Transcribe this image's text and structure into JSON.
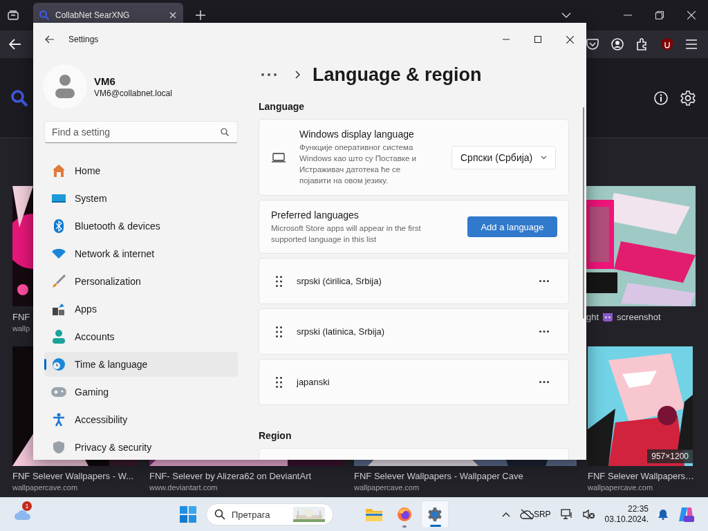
{
  "browser": {
    "tab": {
      "title": "CollabNet SearXNG"
    }
  },
  "results": {
    "row_1": [
      {
        "title": "FNF",
        "site": "wallp"
      },
      {
        "title": "ght",
        "title_end": "screenshot"
      }
    ],
    "row_2": [
      {
        "title": "FNF Selever Wallpapers - W...",
        "site": "wallpapercave.com"
      },
      {
        "title": "FNF- Selever by Alizera62 on DeviantArt",
        "site": "www.deviantart.com"
      },
      {
        "title": "FNF Selever Wallpapers - Wallpaper Cave",
        "site": "wallpapercave.com"
      },
      {
        "title": "FNF Selever Wallpapers…",
        "site": "wallpapercave.com",
        "size": "957×1200"
      }
    ]
  },
  "settings": {
    "title": "Settings",
    "user": {
      "name": "VM6",
      "email": "VM6@collabnet.local"
    },
    "search": {
      "placeholder": "Find a setting"
    },
    "nav": [
      {
        "label": "Home",
        "selected": false
      },
      {
        "label": "System",
        "selected": false
      },
      {
        "label": "Bluetooth & devices",
        "selected": false
      },
      {
        "label": "Network & internet",
        "selected": false
      },
      {
        "label": "Personalization",
        "selected": false
      },
      {
        "label": "Apps",
        "selected": false
      },
      {
        "label": "Accounts",
        "selected": false
      },
      {
        "label": "Time & language",
        "selected": true
      },
      {
        "label": "Gaming",
        "selected": false
      },
      {
        "label": "Accessibility",
        "selected": false
      },
      {
        "label": "Privacy & security",
        "selected": false
      }
    ],
    "page_title": "Language & region",
    "language": {
      "heading": "Language",
      "display_language": {
        "title": "Windows display language",
        "description": "Функције оперативног система Windows као што су Поставке и Истраживач датотека ће се појавити на овом језику.",
        "value": "Српски (Србија)"
      },
      "preferred": {
        "title": "Preferred languages",
        "description": "Microsoft Store apps will appear in the first supported language in this list",
        "button": "Add a language"
      },
      "languages": [
        {
          "name": "srpski (ćirilica, Srbija)"
        },
        {
          "name": "srpski (latinica, Srbija)"
        },
        {
          "name": "japanski"
        }
      ]
    },
    "region": {
      "heading": "Region"
    }
  },
  "taskbar": {
    "weather_badge": "1",
    "search": {
      "placeholder": "Претрага"
    },
    "apps": [
      {
        "running": false,
        "selected": false
      },
      {
        "running": true,
        "selected": false
      },
      {
        "running": true,
        "selected": true
      }
    ],
    "tray": {
      "input_language": "SRP",
      "time": "22:35",
      "date": "03.10.2024."
    }
  }
}
